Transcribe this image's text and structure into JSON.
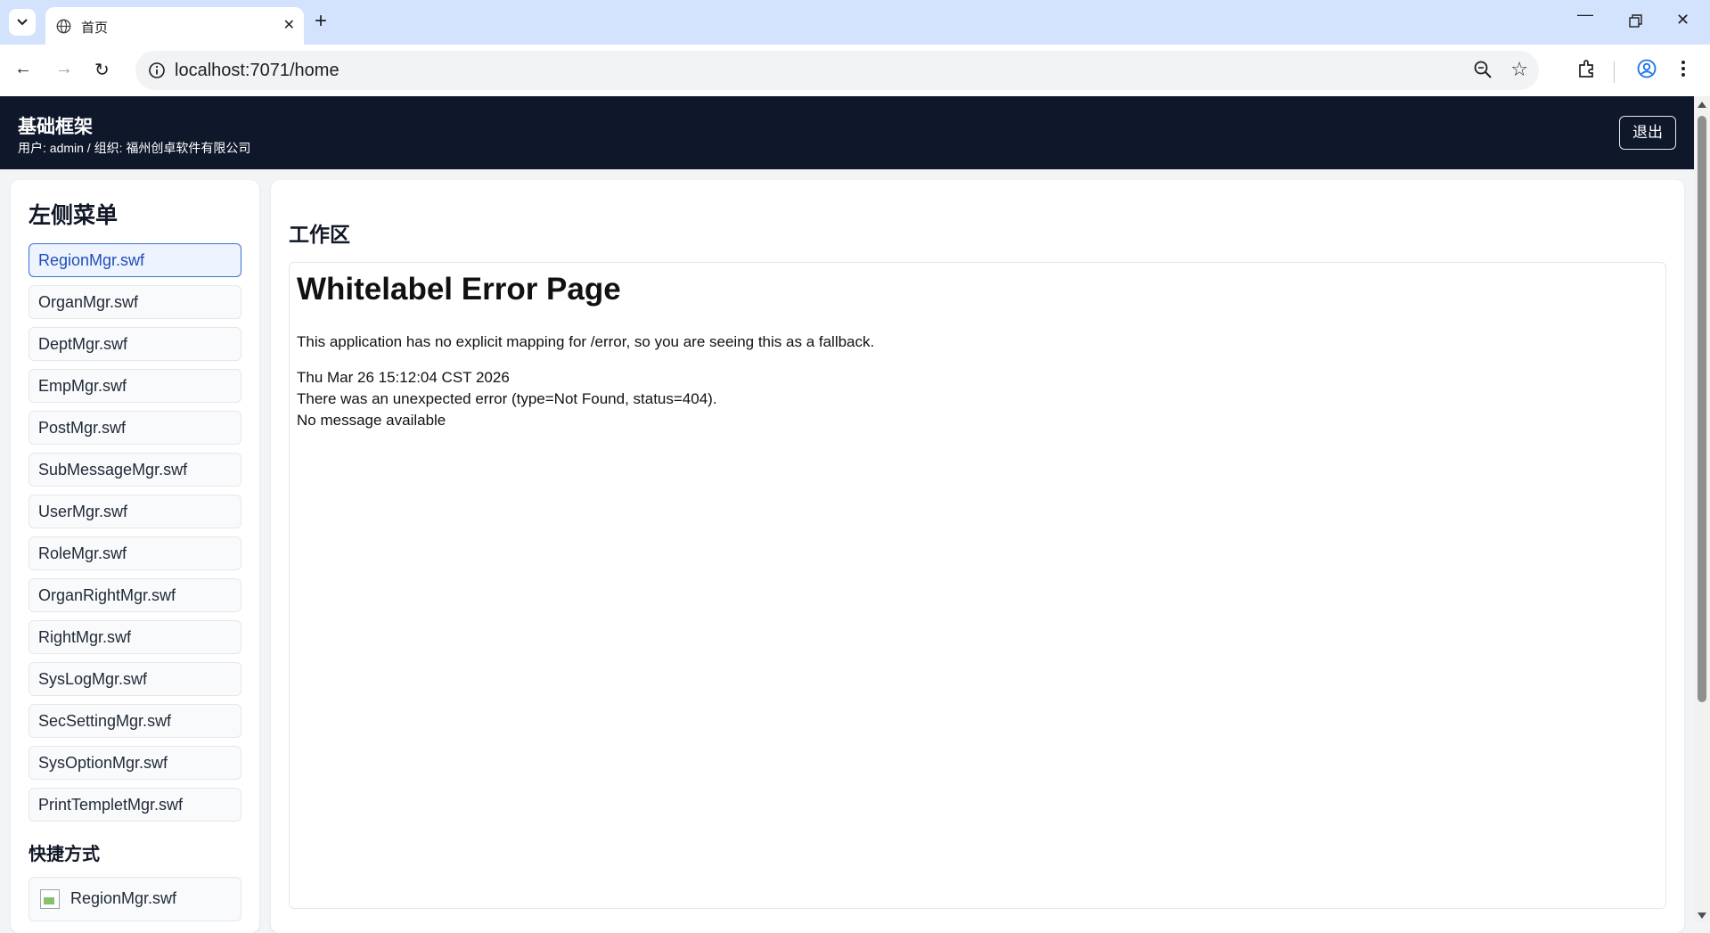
{
  "browser": {
    "tab_title": "首页",
    "url": "localhost:7071/home"
  },
  "header": {
    "title": "基础框架",
    "subtitle": "用户: admin / 组织: 福州创卓软件有限公司",
    "logout_label": "退出"
  },
  "sidebar": {
    "title": "左侧菜单",
    "items": [
      {
        "label": "RegionMgr.swf"
      },
      {
        "label": "OrganMgr.swf"
      },
      {
        "label": "DeptMgr.swf"
      },
      {
        "label": "EmpMgr.swf"
      },
      {
        "label": "PostMgr.swf"
      },
      {
        "label": "SubMessageMgr.swf"
      },
      {
        "label": "UserMgr.swf"
      },
      {
        "label": "RoleMgr.swf"
      },
      {
        "label": "OrganRightMgr.swf"
      },
      {
        "label": "RightMgr.swf"
      },
      {
        "label": "SysLogMgr.swf"
      },
      {
        "label": "SecSettingMgr.swf"
      },
      {
        "label": "SysOptionMgr.swf"
      },
      {
        "label": "PrintTempletMgr.swf"
      }
    ],
    "active_index": 0,
    "shortcut_title": "快捷方式",
    "shortcuts": [
      {
        "label": "RegionMgr.swf"
      }
    ]
  },
  "main": {
    "title": "工作区",
    "error": {
      "title": "Whitelabel Error Page",
      "message": "This application has no explicit mapping for /error, so you are seeing this as a fallback.",
      "timestamp": "Thu Mar 26 15:12:04 CST 2026",
      "detail": "There was an unexpected error (type=Not Found, status=404).",
      "note": "No message available"
    }
  },
  "colors": {
    "header_bg": "#0f172a",
    "tabstrip_bg": "#d3e3fd",
    "active_border": "#3b6fd4"
  }
}
